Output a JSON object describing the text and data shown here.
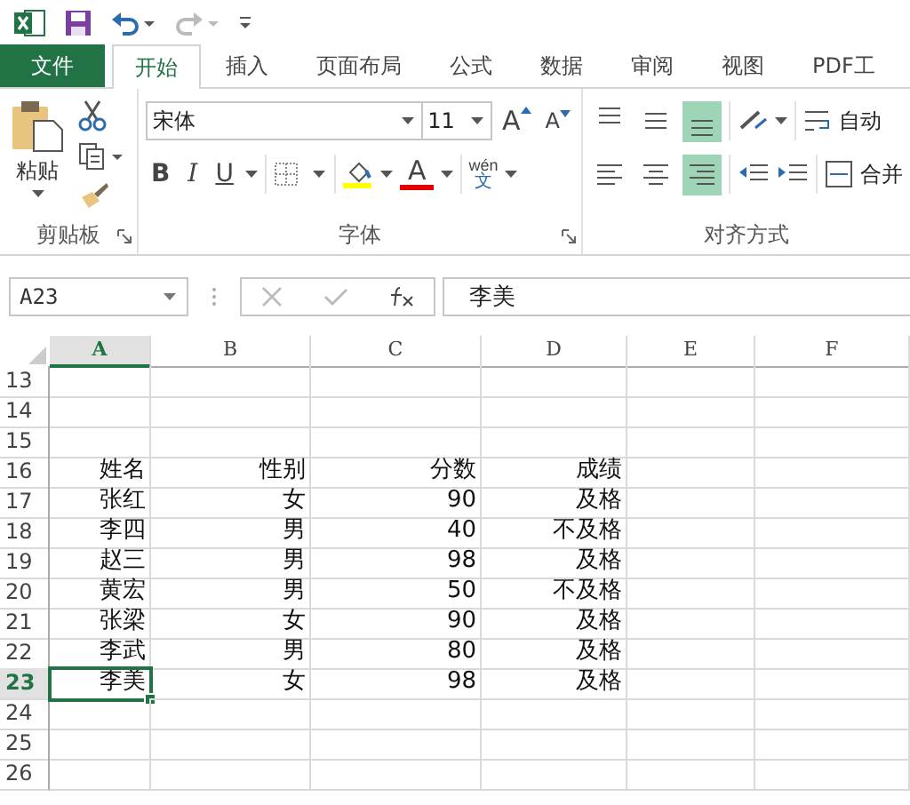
{
  "quick_access": [
    {
      "kind": "excel"
    },
    {
      "kind": "save"
    },
    {
      "kind": "undo"
    },
    {
      "kind": "redo"
    },
    {
      "kind": "customize"
    }
  ],
  "tabs": [
    {
      "label": "文件",
      "kind": "file",
      "selected": false
    },
    {
      "label": "开始",
      "kind": "tab",
      "selected": true
    },
    {
      "label": "插入",
      "kind": "tab",
      "selected": false
    },
    {
      "label": "页面布局",
      "kind": "tab",
      "selected": false
    },
    {
      "label": "公式",
      "kind": "tab",
      "selected": false
    },
    {
      "label": "数据",
      "kind": "tab",
      "selected": false
    },
    {
      "label": "审阅",
      "kind": "tab",
      "selected": false
    },
    {
      "label": "视图",
      "kind": "tab",
      "selected": false
    },
    {
      "label": "PDF工",
      "kind": "tab",
      "selected": false
    }
  ],
  "ribbon": {
    "clipboard": {
      "paste_label": "粘贴",
      "group_label": "剪贴板"
    },
    "font": {
      "font_name": "宋体",
      "font_size": "11",
      "grow_font": "A",
      "shrink_font": "A",
      "bold": "B",
      "italic": "I",
      "underline": "U",
      "font_color": "A",
      "phonetic_top": "wén",
      "phonetic_bottom": "文",
      "group_label": "字体"
    },
    "alignment": {
      "vertical": [
        {
          "kind": "top",
          "selected": false
        },
        {
          "kind": "middle",
          "selected": false
        },
        {
          "kind": "bottom",
          "selected": true
        }
      ],
      "horizontal": [
        {
          "kind": "left",
          "selected": false
        },
        {
          "kind": "center",
          "selected": false
        },
        {
          "kind": "right",
          "selected": true
        }
      ],
      "wrap_text": "自动",
      "merge": "合并",
      "group_label": "对齐方式"
    }
  },
  "formula_bar": {
    "name_box": "A23",
    "formula": "李美"
  },
  "sheet": {
    "columns": [
      {
        "label": "A",
        "selected": true
      },
      {
        "label": "B",
        "selected": false
      },
      {
        "label": "C",
        "selected": false
      },
      {
        "label": "D",
        "selected": false
      },
      {
        "label": "E",
        "selected": false
      },
      {
        "label": "F",
        "selected": false
      }
    ],
    "rows": [
      {
        "number": "13",
        "selected": false
      },
      {
        "number": "14",
        "selected": false
      },
      {
        "number": "15",
        "selected": false
      },
      {
        "number": "16",
        "selected": false,
        "cells": [
          "姓名",
          "性别",
          "分数",
          "成绩"
        ]
      },
      {
        "number": "17",
        "selected": false,
        "cells": [
          "张红",
          "女",
          "90",
          "及格"
        ]
      },
      {
        "number": "18",
        "selected": false,
        "cells": [
          "李四",
          "男",
          "40",
          "不及格"
        ]
      },
      {
        "number": "19",
        "selected": false,
        "cells": [
          "赵三",
          "男",
          "98",
          "及格"
        ]
      },
      {
        "number": "20",
        "selected": false,
        "cells": [
          "黄宏",
          "男",
          "50",
          "不及格"
        ]
      },
      {
        "number": "21",
        "selected": false,
        "cells": [
          "张梁",
          "女",
          "90",
          "及格"
        ]
      },
      {
        "number": "22",
        "selected": false,
        "cells": [
          "李武",
          "男",
          "80",
          "及格"
        ]
      },
      {
        "number": "23",
        "selected": true,
        "cells": [
          "李美",
          "女",
          "98",
          "及格"
        ]
      },
      {
        "number": "24",
        "selected": false
      },
      {
        "number": "25",
        "selected": false
      },
      {
        "number": "26",
        "selected": false
      }
    ]
  }
}
